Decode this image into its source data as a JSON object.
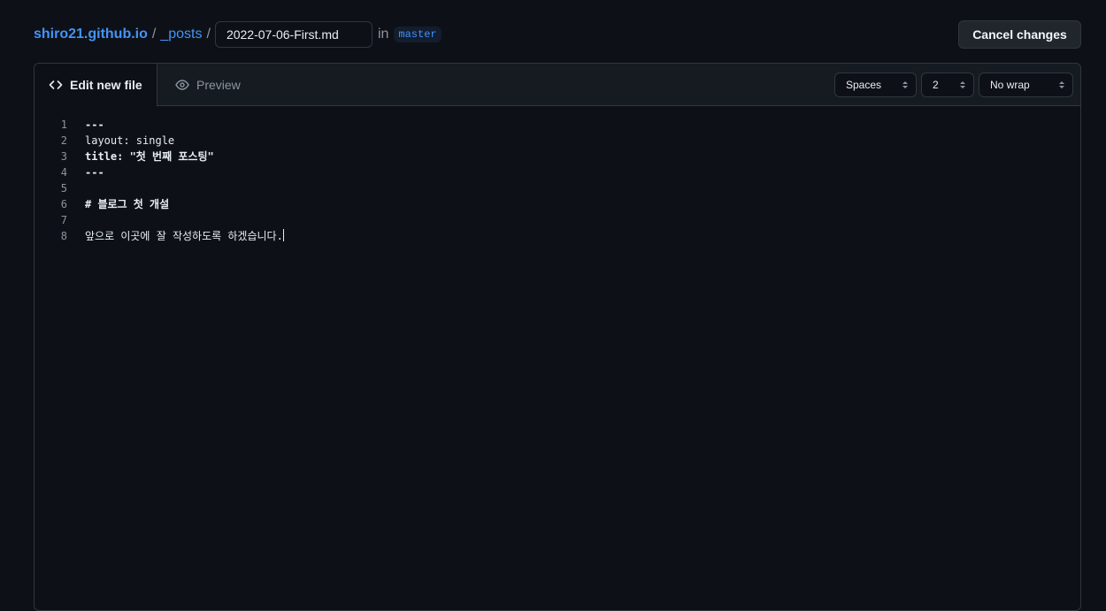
{
  "breadcrumb": {
    "repo": "shiro21.github.io",
    "folder": "_posts",
    "separator": "/",
    "filename": "2022-07-06-First.md",
    "in_label": "in",
    "branch": "master"
  },
  "actions": {
    "cancel_label": "Cancel changes"
  },
  "tabs": {
    "edit_label": "Edit new file",
    "preview_label": "Preview"
  },
  "editor_settings": {
    "indent_mode": "Spaces",
    "indent_size": "2",
    "wrap_mode": "No wrap"
  },
  "code_lines": [
    {
      "n": "1",
      "text": "---"
    },
    {
      "n": "2",
      "text": "layout: single"
    },
    {
      "n": "3",
      "text": "title: \"첫 번째 포스팅\""
    },
    {
      "n": "4",
      "text": "---"
    },
    {
      "n": "5",
      "text": ""
    },
    {
      "n": "6",
      "text": "# 블로그 첫 개설"
    },
    {
      "n": "7",
      "text": ""
    },
    {
      "n": "8",
      "text": "앞으로 이곳에 잘 작성하도록 하겠습니다."
    }
  ],
  "icons": {
    "edit": "code-icon",
    "preview": "eye-icon",
    "select_arrows": "up-down-arrows-icon"
  },
  "colors": {
    "background": "#0d1117",
    "accent": "#4493f8"
  }
}
